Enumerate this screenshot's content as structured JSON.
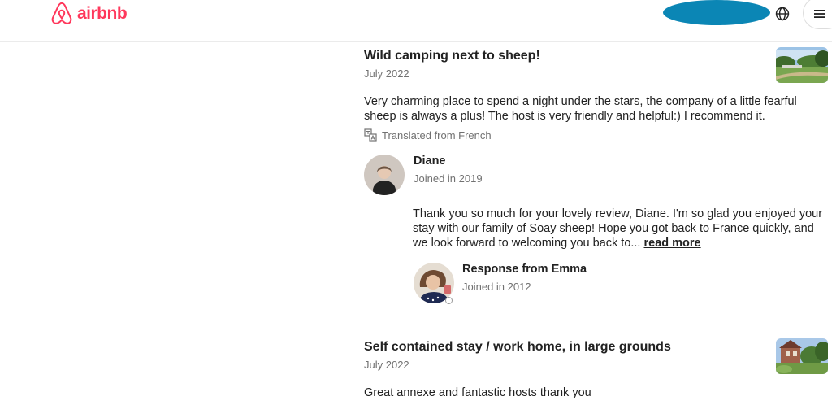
{
  "header": {
    "brand": "airbnb",
    "colors": {
      "brand": "#ff385c",
      "user_pill": "#0b86b5"
    },
    "icons": {
      "logo": "airbnb-logo-icon",
      "globe": "globe-icon",
      "menu": "hamburger-menu-icon"
    }
  },
  "reviews": [
    {
      "title": "Wild camping next to sheep!",
      "date": "July 2022",
      "body": "Very charming place to spend a night under the stars, the company of a little fearful sheep is always a plus! The host is very friendly and helpful:) I recommend it.",
      "translated_note": "Translated from French",
      "reviewer": {
        "name": "Diane",
        "joined": "Joined in 2019"
      },
      "response": {
        "text": "Thank you so much for your lovely review, Diane.  I'm so glad you enjoyed your stay with our family of Soay sheep!  Hope you got back to France quickly, and we look forward to welcoming you back to...",
        "read_more": "read more",
        "from": "Response from Emma",
        "joined": "Joined in 2012"
      }
    },
    {
      "title": "Self contained stay / work home, in large grounds",
      "date": "July 2022",
      "body": "Great annexe and fantastic hosts thank you"
    }
  ]
}
